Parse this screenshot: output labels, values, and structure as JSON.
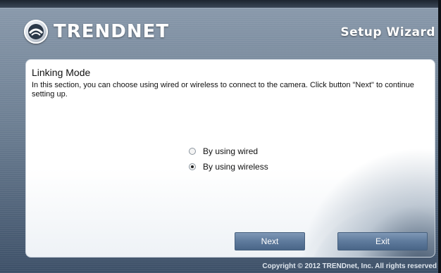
{
  "header": {
    "brand": "TRENDNET",
    "logo_icon": "trendnet-logo-icon",
    "wizard_title": "Setup Wizard"
  },
  "panel": {
    "heading": "Linking Mode",
    "description": "In this section, you can choose using wired or wireless to connect to the camera. Click button \"Next\" to continue setting up.",
    "options": [
      {
        "label": "By using wired",
        "checked": false
      },
      {
        "label": "By using wireless",
        "checked": true
      }
    ]
  },
  "buttons": {
    "next_label": "Next",
    "exit_label": "Exit"
  },
  "footer": {
    "copyright": "Copyright © 2012 TRENDnet, Inc. All rights reserved"
  },
  "colors": {
    "button": "#5e7a9c",
    "panel_border": "#c9d2dc",
    "header_text": "#ffffff"
  }
}
